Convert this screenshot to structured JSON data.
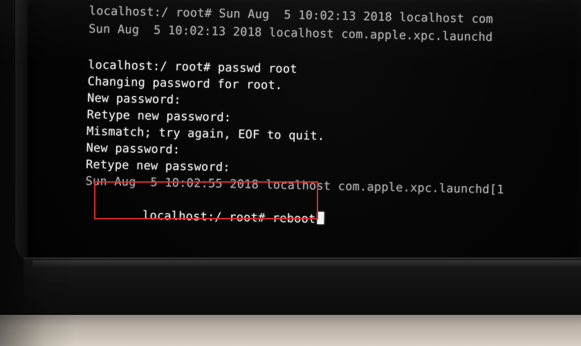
{
  "terminal": {
    "lines": [
      "localhost:/ root# Sun Aug  5 10:02:13 2018 localhost com",
      "Sun Aug  5 10:02:13 2018 localhost com.apple.xpc.launchd",
      "",
      "localhost:/ root# passwd root",
      "Changing password for root.",
      "New password:",
      "Retype new password:",
      "Mismatch; try again, EOF to quit.",
      "New password:",
      "Retype new password:",
      "Sun Aug  5 10:02:55 2018 localhost com.apple.xpc.launchd[1",
      "localhost:/ root# reboot"
    ]
  },
  "annotation": {
    "highlight_color": "#d62f2f"
  }
}
